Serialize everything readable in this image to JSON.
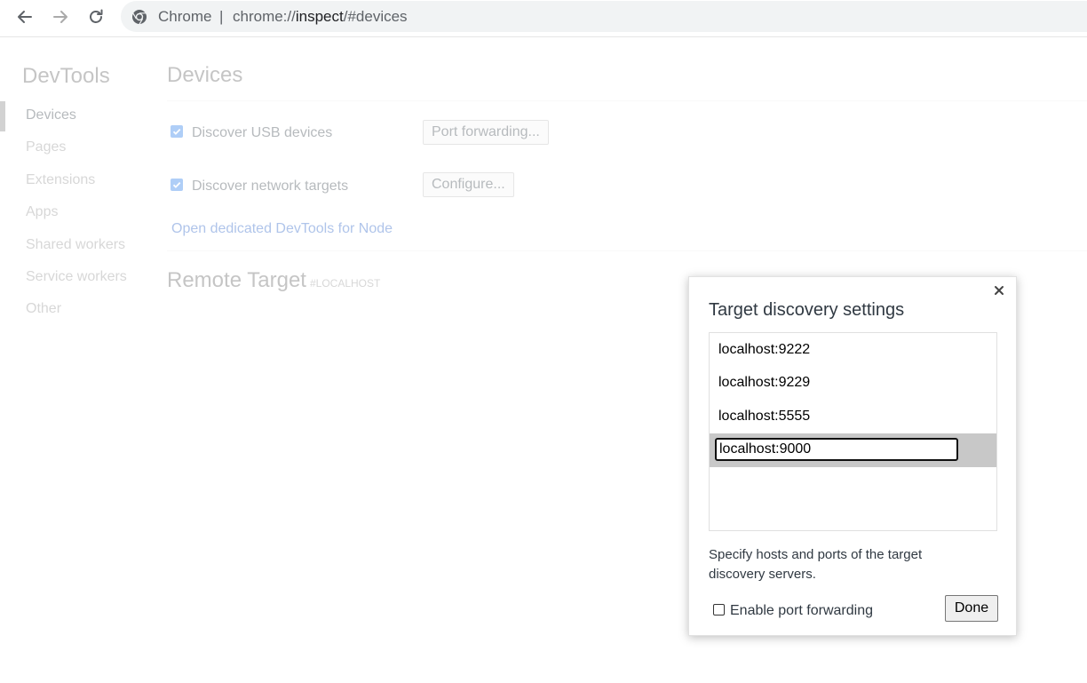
{
  "browser": {
    "chip_label": "Chrome",
    "separator": "|",
    "url_scheme": "chrome://",
    "url_host": "inspect",
    "url_path": "/#devices",
    "icons": {
      "back": "arrow-left-icon",
      "forward": "arrow-right-icon",
      "reload": "reload-icon",
      "site": "chrome-logo-icon"
    }
  },
  "sidebar": {
    "title": "DevTools",
    "items": [
      {
        "label": "Devices",
        "selected": true
      },
      {
        "label": "Pages"
      },
      {
        "label": "Extensions"
      },
      {
        "label": "Apps"
      },
      {
        "label": "Shared workers"
      },
      {
        "label": "Service workers"
      },
      {
        "label": "Other"
      }
    ]
  },
  "main": {
    "title": "Devices",
    "usb": {
      "label": "Discover USB devices",
      "checked": true,
      "button": "Port forwarding..."
    },
    "network": {
      "label": "Discover network targets",
      "checked": true,
      "button": "Configure..."
    },
    "node_link": "Open dedicated DevTools for Node",
    "remote_target": {
      "title": "Remote Target",
      "subtitle": "#LOCALHOST"
    }
  },
  "dialog": {
    "title": "Target discovery settings",
    "close_icon": "close-icon",
    "hosts": [
      "localhost:9222",
      "localhost:9229",
      "localhost:5555"
    ],
    "editing_value": "localhost:9000",
    "description": "Specify hosts and ports of the target discovery servers.",
    "port_forwarding": {
      "label": "Enable port forwarding",
      "checked": false
    },
    "done_label": "Done"
  },
  "colors": {
    "accent": "#1a73e8",
    "link": "#1a56c2",
    "editing_row": "#c8c8c8",
    "omnibox": "#f1f3f4"
  }
}
